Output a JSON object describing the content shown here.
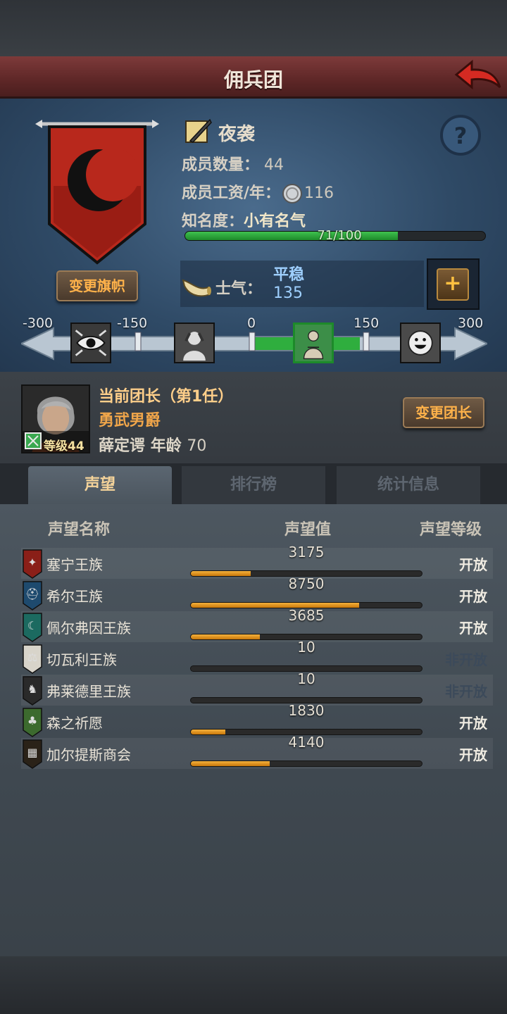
{
  "header": {
    "title": "佣兵团"
  },
  "company": {
    "name": "夜袭",
    "members_label": "成员数量：",
    "members_value": "44",
    "wage_label": "成员工资/年：",
    "wage_value": "116",
    "fame_label": "知名度：",
    "fame_value": "小有名气",
    "fame_progress_text": "71/100",
    "fame_progress": 0.71,
    "change_flag_label": "变更旗帜",
    "colors": {
      "banner": "#b8281c",
      "fame_bar": "#2fae3e",
      "accent": "#ffb24a"
    }
  },
  "morale": {
    "label": "士气：",
    "state": "平稳",
    "value": "135",
    "plus_label": "+",
    "scale_labels": [
      "-300",
      "-150",
      "0",
      "150",
      "300"
    ],
    "icons": [
      "eye-icon",
      "despair-icon",
      "calm-figure-icon",
      "happy-face-icon"
    ],
    "current_value": 135
  },
  "leader": {
    "title": "当前团长（第1任）",
    "rank": "勇武男爵",
    "name": "薛定谔",
    "age_label": "年龄",
    "age_value": "70",
    "level_label": "等级44",
    "change_button": "变更团长"
  },
  "tabs": [
    {
      "label": "声望",
      "active": true
    },
    {
      "label": "排行榜",
      "active": false
    },
    {
      "label": "统计信息",
      "active": false
    }
  ],
  "table": {
    "headers": [
      "声望名称",
      "声望值",
      "声望等级"
    ],
    "rows": [
      {
        "name": "塞宁王族",
        "value": "3175",
        "fill": 0.26,
        "status": "开放",
        "status_color": "#f0ece2",
        "icon": "tree-crest-icon",
        "icon_color": "#8a1f18"
      },
      {
        "name": "希尔王族",
        "value": "8750",
        "fill": 0.73,
        "status": "开放",
        "status_color": "#f0ece2",
        "icon": "helmet-crest-icon",
        "icon_color": "#1e4a6e"
      },
      {
        "name": "佩尔弗因王族",
        "value": "3685",
        "fill": 0.3,
        "status": "开放",
        "status_color": "#f0ece2",
        "icon": "crescent-crest-icon",
        "icon_color": "#1c6a60"
      },
      {
        "name": "切瓦利王族",
        "value": "10",
        "fill": 0.0,
        "status": "非开放",
        "status_color": "#3c4a5a",
        "icon": "scales-crest-icon",
        "icon_color": "#d8d4ca"
      },
      {
        "name": "弗莱德里王族",
        "value": "10",
        "fill": 0.0,
        "status": "非开放",
        "status_color": "#3c4a5a",
        "icon": "beast-crest-icon",
        "icon_color": "#2a2a2a"
      },
      {
        "name": "森之祈愿",
        "value": "1830",
        "fill": 0.15,
        "status": "开放",
        "status_color": "#f0ece2",
        "icon": "oak-crest-icon",
        "icon_color": "#3c6a2e"
      },
      {
        "name": "加尔提斯商会",
        "value": "4140",
        "fill": 0.34,
        "status": "开放",
        "status_color": "#f0ece2",
        "icon": "guild-crest-icon",
        "icon_color": "#2a2218"
      }
    ]
  }
}
